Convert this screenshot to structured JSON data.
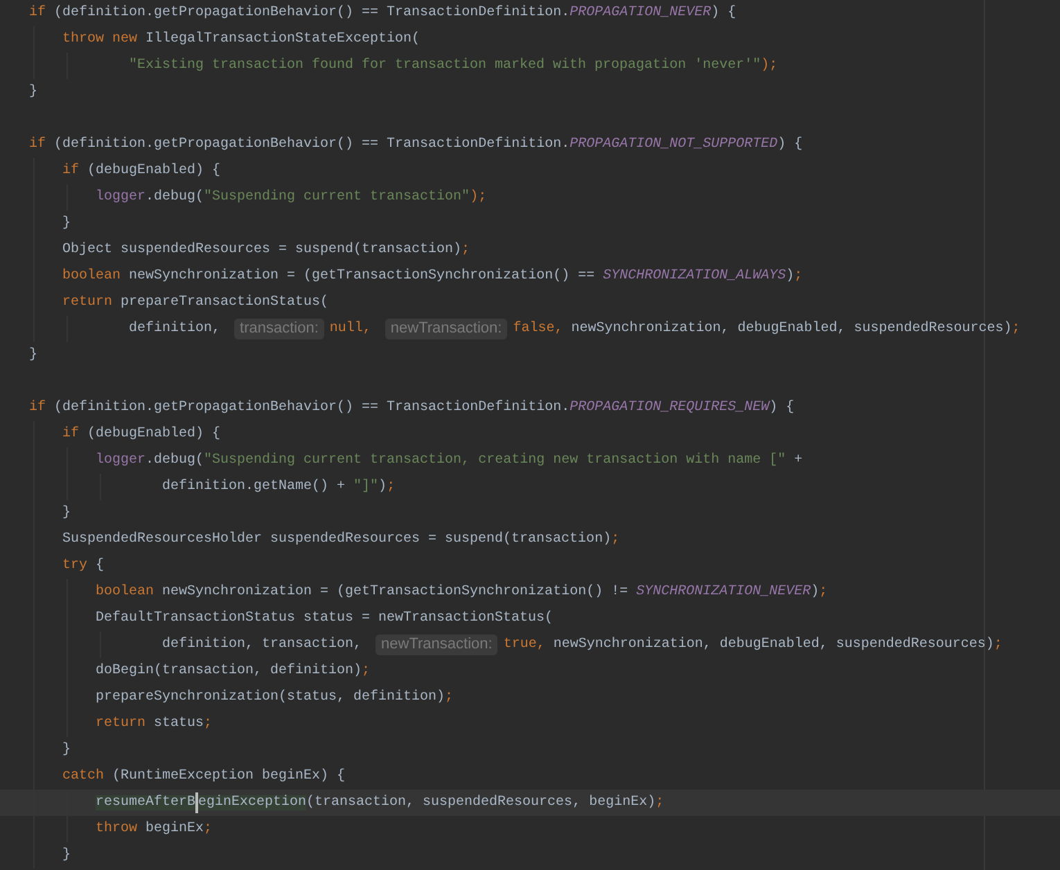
{
  "lines": [
    {
      "kind": "code",
      "tokens": [
        {
          "text": "if",
          "kind": "keyword"
        },
        {
          "text": " (definition.getPropagationBehavior() == TransactionDefinition.",
          "kind": "plain"
        },
        {
          "text": "PROPAGATION_NEVER",
          "kind": "constant"
        },
        {
          "text": ") {",
          "kind": "plain"
        }
      ],
      "children": [
        {
          "kind": "code",
          "tokens": [
            {
              "text": "throw new",
              "kind": "keyword"
            },
            {
              "text": " IllegalTransactionStateException(",
              "kind": "plain"
            }
          ],
          "children": [
            {
              "kind": "continuation",
              "tokens": [
                {
                  "text": "\"Existing transaction found for transaction marked with propagation 'never'\"",
                  "kind": "string"
                },
                {
                  "text": ");",
                  "kind": "keyword"
                }
              ]
            }
          ]
        }
      ]
    },
    {
      "kind": "code",
      "tokens": [
        {
          "text": "}",
          "kind": "plain"
        }
      ]
    },
    {
      "kind": "blank"
    },
    {
      "kind": "code",
      "tokens": [
        {
          "text": "if",
          "kind": "keyword"
        },
        {
          "text": " (definition.getPropagationBehavior() == TransactionDefinition.",
          "kind": "plain"
        },
        {
          "text": "PROPAGATION_NOT_SUPPORTED",
          "kind": "constant"
        },
        {
          "text": ") {",
          "kind": "plain"
        }
      ],
      "children": [
        {
          "kind": "code",
          "tokens": [
            {
              "text": "if",
              "kind": "keyword"
            },
            {
              "text": " (debugEnabled) {",
              "kind": "plain"
            }
          ],
          "children": [
            {
              "kind": "code",
              "tokens": [
                {
                  "text": "logger",
                  "kind": "field"
                },
                {
                  "text": ".debug(",
                  "kind": "plain"
                },
                {
                  "text": "\"Suspending current transaction\"",
                  "kind": "string"
                },
                {
                  "text": ");",
                  "kind": "keyword"
                }
              ]
            }
          ]
        },
        {
          "kind": "code",
          "tokens": [
            {
              "text": "}",
              "kind": "plain"
            }
          ]
        },
        {
          "kind": "code",
          "tokens": [
            {
              "text": "Object suspendedResources = suspend(transaction)",
              "kind": "plain"
            },
            {
              "text": ";",
              "kind": "keyword"
            }
          ]
        },
        {
          "kind": "code",
          "tokens": [
            {
              "text": "boolean",
              "kind": "keyword"
            },
            {
              "text": " newSynchronization = (getTransactionSynchronization() == ",
              "kind": "plain"
            },
            {
              "text": "SYNCHRONIZATION_ALWAYS",
              "kind": "constant"
            },
            {
              "text": ")",
              "kind": "plain"
            },
            {
              "text": ";",
              "kind": "keyword"
            }
          ]
        },
        {
          "kind": "code",
          "tokens": [
            {
              "text": "return",
              "kind": "keyword"
            },
            {
              "text": " prepareTransactionStatus(",
              "kind": "plain"
            }
          ],
          "children": [
            {
              "kind": "continuation",
              "tokens": [
                {
                  "text": "definition, ",
                  "kind": "plain"
                },
                {
                  "text": "transaction:",
                  "kind": "hint"
                },
                {
                  "text": "null, ",
                  "kind": "keyword"
                },
                {
                  "text": "newTransaction:",
                  "kind": "hint"
                },
                {
                  "text": "false, ",
                  "kind": "keyword"
                },
                {
                  "text": "newSynchronization, debugEnabled, suspendedResources)",
                  "kind": "plain"
                },
                {
                  "text": ";",
                  "kind": "keyword"
                }
              ]
            }
          ]
        }
      ]
    },
    {
      "kind": "code",
      "tokens": [
        {
          "text": "}",
          "kind": "plain"
        }
      ]
    },
    {
      "kind": "blank"
    },
    {
      "kind": "code",
      "tokens": [
        {
          "text": "if",
          "kind": "keyword"
        },
        {
          "text": " (definition.getPropagationBehavior() == TransactionDefinition.",
          "kind": "plain"
        },
        {
          "text": "PROPAGATION_REQUIRES_NEW",
          "kind": "constant"
        },
        {
          "text": ") {",
          "kind": "plain"
        }
      ],
      "children": [
        {
          "kind": "code",
          "tokens": [
            {
              "text": "if",
              "kind": "keyword"
            },
            {
              "text": " (debugEnabled) {",
              "kind": "plain"
            }
          ],
          "children": [
            {
              "kind": "code",
              "tokens": [
                {
                  "text": "logger",
                  "kind": "field"
                },
                {
                  "text": ".debug(",
                  "kind": "plain"
                },
                {
                  "text": "\"Suspending current transaction, creating new transaction with name [\"",
                  "kind": "string"
                },
                {
                  "text": " +",
                  "kind": "plain"
                }
              ],
              "children": [
                {
                  "kind": "continuation",
                  "tokens": [
                    {
                      "text": "definition.getName() + ",
                      "kind": "plain"
                    },
                    {
                      "text": "\"]\"",
                      "kind": "string"
                    },
                    {
                      "text": ")",
                      "kind": "plain"
                    },
                    {
                      "text": ";",
                      "kind": "keyword"
                    }
                  ]
                }
              ]
            }
          ]
        },
        {
          "kind": "code",
          "tokens": [
            {
              "text": "}",
              "kind": "plain"
            }
          ]
        },
        {
          "kind": "code",
          "tokens": [
            {
              "text": "SuspendedResourcesHolder suspendedResources = suspend(transaction)",
              "kind": "plain"
            },
            {
              "text": ";",
              "kind": "keyword"
            }
          ]
        },
        {
          "kind": "code",
          "tokens": [
            {
              "text": "try",
              "kind": "keyword"
            },
            {
              "text": " {",
              "kind": "plain"
            }
          ],
          "children": [
            {
              "kind": "code",
              "tokens": [
                {
                  "text": "boolean",
                  "kind": "keyword"
                },
                {
                  "text": " newSynchronization = (getTransactionSynchronization() != ",
                  "kind": "plain"
                },
                {
                  "text": "SYNCHRONIZATION_NEVER",
                  "kind": "constant"
                },
                {
                  "text": ")",
                  "kind": "plain"
                },
                {
                  "text": ";",
                  "kind": "keyword"
                }
              ]
            },
            {
              "kind": "code",
              "tokens": [
                {
                  "text": "DefaultTransactionStatus status = newTransactionStatus(",
                  "kind": "plain"
                }
              ],
              "children": [
                {
                  "kind": "continuation",
                  "tokens": [
                    {
                      "text": "definition, transaction, ",
                      "kind": "plain"
                    },
                    {
                      "text": "newTransaction:",
                      "kind": "hint"
                    },
                    {
                      "text": "true, ",
                      "kind": "keyword"
                    },
                    {
                      "text": "newSynchronization, debugEnabled, suspendedResources)",
                      "kind": "plain"
                    },
                    {
                      "text": ";",
                      "kind": "keyword"
                    }
                  ]
                }
              ]
            },
            {
              "kind": "code",
              "tokens": [
                {
                  "text": "doBegin(transaction, definition)",
                  "kind": "plain"
                },
                {
                  "text": ";",
                  "kind": "keyword"
                }
              ]
            },
            {
              "kind": "code",
              "tokens": [
                {
                  "text": "prepareSynchronization(status, definition)",
                  "kind": "plain"
                },
                {
                  "text": ";",
                  "kind": "keyword"
                }
              ]
            },
            {
              "kind": "code",
              "tokens": [
                {
                  "text": "return",
                  "kind": "keyword"
                },
                {
                  "text": " status",
                  "kind": "plain"
                },
                {
                  "text": ";",
                  "kind": "keyword"
                }
              ]
            }
          ]
        },
        {
          "kind": "code",
          "tokens": [
            {
              "text": "}",
              "kind": "plain"
            }
          ]
        },
        {
          "kind": "code",
          "tokens": [
            {
              "text": "catch",
              "kind": "keyword"
            },
            {
              "text": " (RuntimeException beginEx) {",
              "kind": "plain"
            }
          ],
          "children": [
            {
              "kind": "code",
              "current": true,
              "tokens": [
                {
                  "text": "resumeAfterB",
                  "kind": "usage",
                  "caret": true
                },
                {
                  "text": "eginException",
                  "kind": "usage"
                },
                {
                  "text": "(transaction, suspendedResources, beginEx)",
                  "kind": "plain"
                },
                {
                  "text": ";",
                  "kind": "keyword"
                }
              ]
            },
            {
              "kind": "code",
              "tokens": [
                {
                  "text": "throw",
                  "kind": "keyword"
                },
                {
                  "text": " beginEx",
                  "kind": "plain"
                },
                {
                  "text": ";",
                  "kind": "keyword"
                }
              ]
            }
          ]
        },
        {
          "kind": "code",
          "tokens": [
            {
              "text": "}",
              "kind": "plain"
            }
          ]
        }
      ]
    }
  ]
}
